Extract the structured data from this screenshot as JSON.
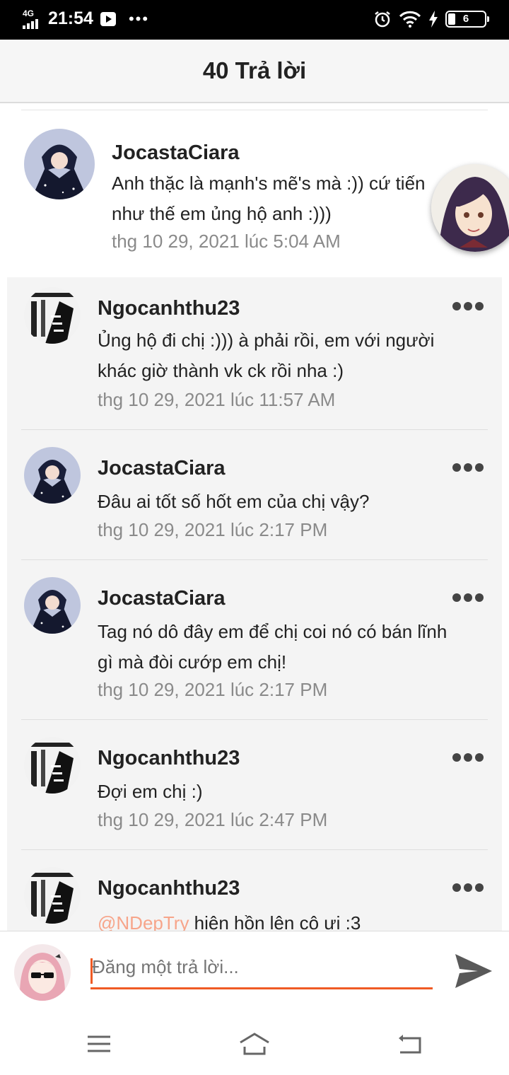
{
  "status_bar": {
    "network": "4G",
    "time": "21:54",
    "overflow": "•••",
    "battery": "6",
    "icons": [
      "signal-icon",
      "youtube-icon",
      "alarm-icon",
      "wifi-icon",
      "charging-icon",
      "battery-icon"
    ]
  },
  "header": {
    "title": "40 Trả lời"
  },
  "parent_comment": {
    "username": "JocastaCiara",
    "text_line1": "Anh thặc là mạnh's mẽ's mà :)) cứ tiến",
    "text_line2": "như thế em ủng hộ anh :)))",
    "timestamp": "thg 10 29, 2021 lúc 5:04 AM"
  },
  "replies": [
    {
      "username": "Ngocanhthu23",
      "text_line1": "Ủng hộ đi chị :))) à phải rồi, em với người",
      "text_line2": "khác giờ thành vk ck rồi nha :)",
      "timestamp": "thg 10 29, 2021 lúc 11:57 AM"
    },
    {
      "username": "JocastaCiara",
      "text_line1": "Đâu ai tốt số hốt em của chị vậy?",
      "timestamp": "thg 10 29, 2021 lúc 2:17 PM"
    },
    {
      "username": "JocastaCiara",
      "text_line1": "Tag nó dô đây em để chị coi nó có bán lĩnh",
      "text_line2": "gì mà đòi cướp em chị!",
      "timestamp": "thg 10 29, 2021 lúc 2:17 PM"
    },
    {
      "username": "Ngocanhthu23",
      "text_line1": "Đợi em chị :)",
      "timestamp": "thg 10 29, 2021 lúc 2:47 PM"
    },
    {
      "username": "Ngocanhthu23",
      "mention": "@NDepTry",
      "text_line1": " hiện hồn lên cô ưi :3"
    }
  ],
  "composer": {
    "placeholder": "Đăng một trả lời..."
  },
  "colors": {
    "accent": "#ef5a24",
    "reply_bg": "#f4f4f4",
    "mention": "#f7a58a",
    "timestamp": "#8a8a8a"
  }
}
